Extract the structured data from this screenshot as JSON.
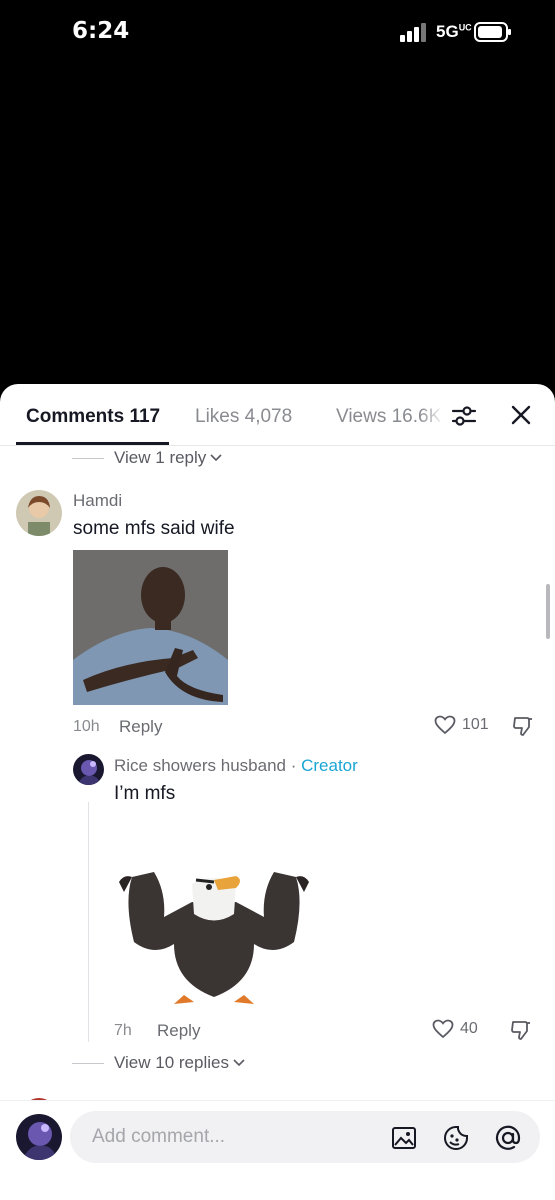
{
  "status_bar": {
    "time": "6:24",
    "network": "5G",
    "network_sup": "UC"
  },
  "tabs": [
    {
      "label": "Comments 117"
    },
    {
      "label": "Likes 4,078"
    },
    {
      "label": "Views 16.6K"
    }
  ],
  "thread_top": {
    "view_replies_label": "View 1 reply"
  },
  "comment": {
    "username": "Hamdi",
    "text": "some mfs said wife",
    "image_icon": "person-time-out-gesture-photo",
    "time": "10h",
    "reply_label": "Reply",
    "likes": "101"
  },
  "reply": {
    "username": "Rice showers husband",
    "separator": " · ",
    "badge": "Creator",
    "text": "I’m mfs",
    "image_icon": "eagle-flexing-sticker",
    "time": "7h",
    "reply_label": "Reply",
    "likes": "40",
    "view_more_label": "View 10 replies"
  },
  "input": {
    "placeholder": "Add comment..."
  },
  "colors": {
    "accent": "#1aa6d4",
    "text": "#161823",
    "muted": "#8a8b91"
  }
}
